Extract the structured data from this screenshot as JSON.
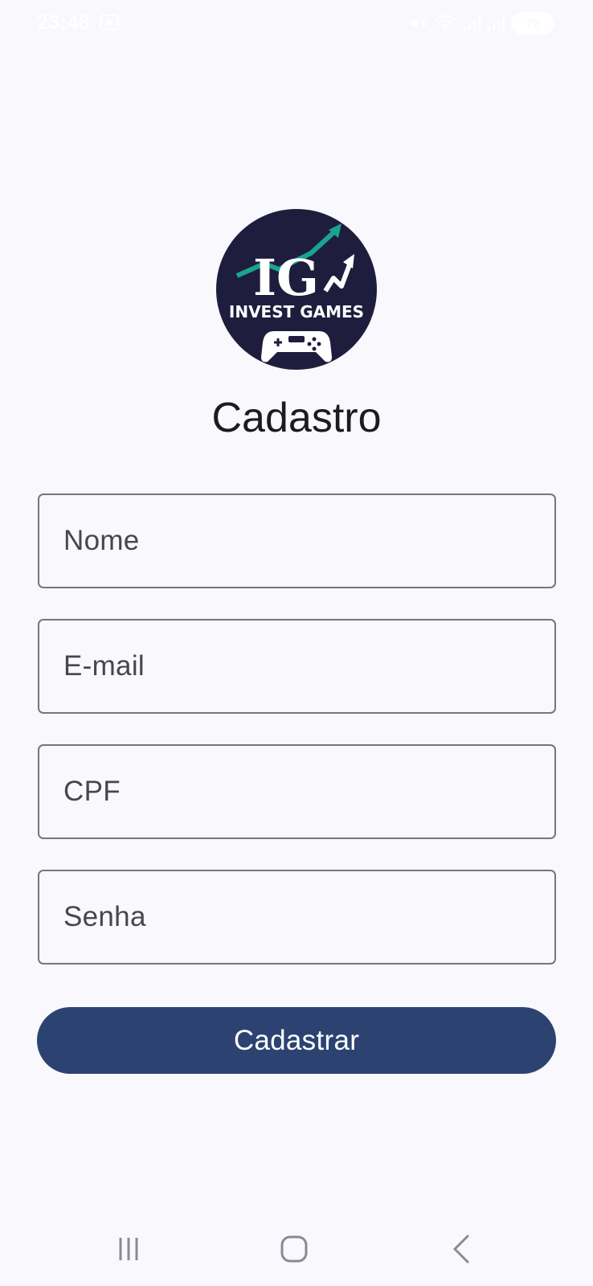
{
  "status_bar": {
    "time": "23:48",
    "battery": "72",
    "icons": [
      "screenshot-icon",
      "mute-icon",
      "wifi-icon",
      "signal-icon",
      "signal-icon",
      "battery-icon"
    ]
  },
  "logo": {
    "letters": "IG",
    "name": "INVEST GAMES",
    "colors": {
      "background": "#1f1d3d",
      "accent": "#1aa48e",
      "text": "#ffffff"
    }
  },
  "page": {
    "title": "Cadastro"
  },
  "form": {
    "fields": [
      {
        "placeholder": "Nome"
      },
      {
        "placeholder": "E-mail"
      },
      {
        "placeholder": "CPF"
      },
      {
        "placeholder": "Senha"
      }
    ],
    "submit_label": "Cadastrar"
  },
  "colors": {
    "background": "#f8f8fd",
    "button": "#2c4371",
    "field_border": "#79747e"
  },
  "nav_bar": {
    "icons": [
      "recent-apps-icon",
      "home-icon",
      "back-icon"
    ]
  }
}
